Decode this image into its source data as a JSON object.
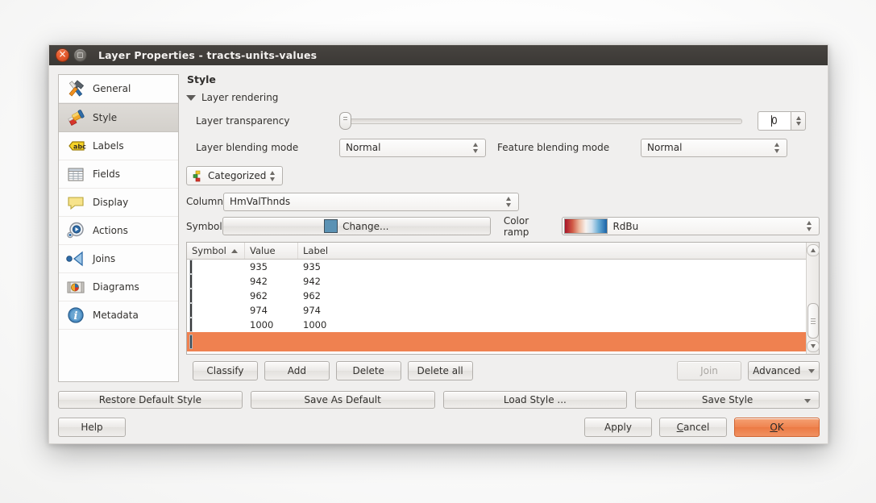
{
  "window": {
    "title": "Layer Properties - tracts-units-values",
    "close_icon": "close-icon",
    "maximize_icon": "maximize-icon"
  },
  "sidebar": {
    "items": [
      {
        "label": "General",
        "icon": "hammer-wrench-icon",
        "active": false
      },
      {
        "label": "Style",
        "icon": "paintbrush-icon",
        "active": true
      },
      {
        "label": "Labels",
        "icon": "abc-label-icon",
        "active": false
      },
      {
        "label": "Fields",
        "icon": "table-grid-icon",
        "active": false
      },
      {
        "label": "Display",
        "icon": "speech-bubble-icon",
        "active": false
      },
      {
        "label": "Actions",
        "icon": "gear-play-icon",
        "active": false
      },
      {
        "label": "Joins",
        "icon": "join-arrow-icon",
        "active": false
      },
      {
        "label": "Diagrams",
        "icon": "pie-chart-icon",
        "active": false
      },
      {
        "label": "Metadata",
        "icon": "info-icon",
        "active": false
      }
    ]
  },
  "panel": {
    "title": "Style",
    "rendering_group": "Layer rendering",
    "transparency_label": "Layer transparency",
    "transparency_value": "0",
    "layer_blending_label": "Layer blending mode",
    "layer_blending_value": "Normal",
    "feature_blending_label": "Feature blending mode",
    "feature_blending_value": "Normal",
    "renderer_value": "Categorized",
    "column_label": "Column",
    "column_value": "HmValThnds",
    "symbol_label": "Symbol",
    "symbol_button": "Change...",
    "color_ramp_label": "Color ramp",
    "color_ramp_value": "RdBu"
  },
  "table": {
    "headers": {
      "symbol": "Symbol",
      "value": "Value",
      "label": "Label"
    },
    "sort_indicator": "ascending",
    "rows": [
      {
        "value": "935",
        "label": "935",
        "selected": false
      },
      {
        "value": "942",
        "label": "942",
        "selected": false
      },
      {
        "value": "962",
        "label": "962",
        "selected": false
      },
      {
        "value": "974",
        "label": "974",
        "selected": false
      },
      {
        "value": "1000",
        "label": "1000",
        "selected": false
      },
      {
        "value": "",
        "label": "",
        "selected": true
      }
    ]
  },
  "actions": {
    "classify": "Classify",
    "add": "Add",
    "delete": "Delete",
    "delete_all": "Delete all",
    "join": "Join",
    "join_disabled": true,
    "advanced": "Advanced"
  },
  "style_bar": {
    "restore_default": "Restore Default Style",
    "save_as_default": "Save As Default",
    "load_style": "Load Style ...",
    "save_style": "Save Style"
  },
  "footer": {
    "help": "Help",
    "apply": "Apply",
    "cancel_pre": "",
    "cancel_mnemonic": "C",
    "cancel_post": "ancel",
    "ok_pre": "",
    "ok_mnemonic": "O",
    "ok_post": "K"
  },
  "colors": {
    "accent_orange": "#ef8150",
    "symbol_blue": "#1c6ba8",
    "titlebar": "#3b3835",
    "dialog_bg": "#f0efee"
  }
}
